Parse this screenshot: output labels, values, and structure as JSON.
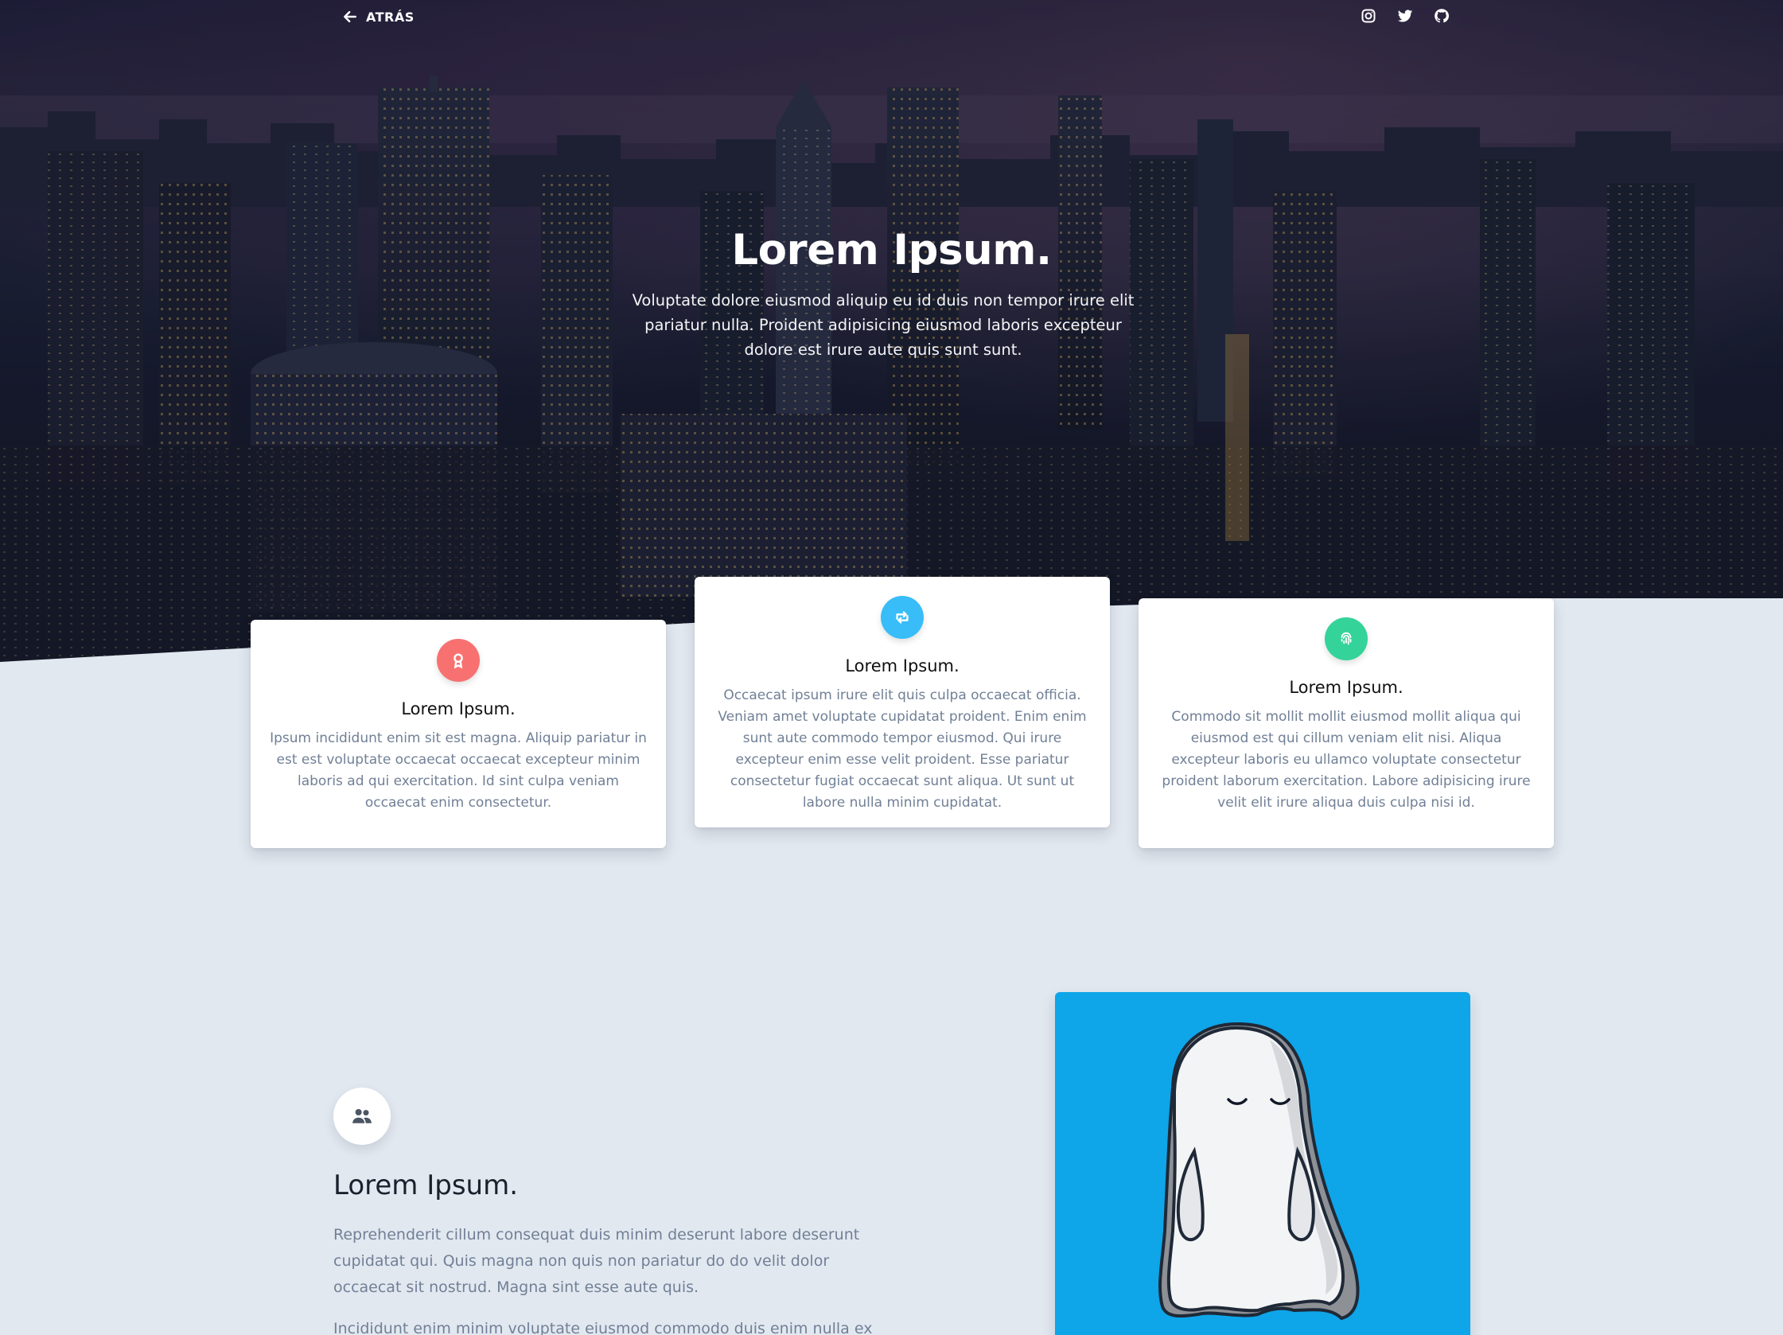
{
  "nav": {
    "back_label": "ATRÁS",
    "social": [
      "instagram-icon",
      "twitter-icon",
      "github-icon"
    ]
  },
  "hero": {
    "title": "Lorem Ipsum.",
    "subtitle": "Voluptate dolore eiusmod aliquip eu id duis non tempor irure elit pariatur nulla. Proident adipisicing eiusmod laboris excepteur dolore est irure aute quis sunt sunt."
  },
  "cards": [
    {
      "icon": "award-icon",
      "icon_color": "#f87171",
      "title": "Lorem Ipsum.",
      "text": "Ipsum incididunt enim sit est magna. Aliquip pariatur in est est voluptate occaecat occaecat excepteur minim laboris ad qui exercitation. Id sint culpa veniam occaecat enim consectetur."
    },
    {
      "icon": "retweet-icon",
      "icon_color": "#38bdf8",
      "title": "Lorem Ipsum.",
      "text": "Occaecat ipsum irure elit quis culpa occaecat officia. Veniam amet voluptate cupidatat proident. Enim enim sunt aute commodo tempor eiusmod. Qui irure excepteur enim esse velit proident. Esse pariatur consectetur fugiat occaecat sunt aliqua. Ut sunt ut labore nulla minim cupidatat."
    },
    {
      "icon": "fingerprint-icon",
      "icon_color": "#34d399",
      "title": "Lorem Ipsum.",
      "text": "Commodo sit mollit mollit eiusmod mollit aliqua qui eiusmod est qui cillum veniam elit nisi. Aliqua excepteur laboris eu ullamco voluptate consectetur proident laborum exercitation. Labore adipisicing irure velit elit irure aliqua duis culpa nisi id."
    }
  ],
  "feature": {
    "icon": "users-icon",
    "title": "Lorem Ipsum.",
    "paragraph1": "Reprehenderit cillum consequat duis minim deserunt labore deserunt cupidatat qui. Quis magna non quis non pariatur do do velit dolor occaecat sit nostrud. Magna sint esse aute quis.",
    "paragraph2": "Incididunt enim minim voluptate eiusmod commodo duis enim nulla ex"
  },
  "illustration": {
    "name": "ghost-illustration",
    "background": "#0ea5e9"
  },
  "colors": {
    "page_bg": "#e2e8f0",
    "text_muted": "#718096"
  }
}
